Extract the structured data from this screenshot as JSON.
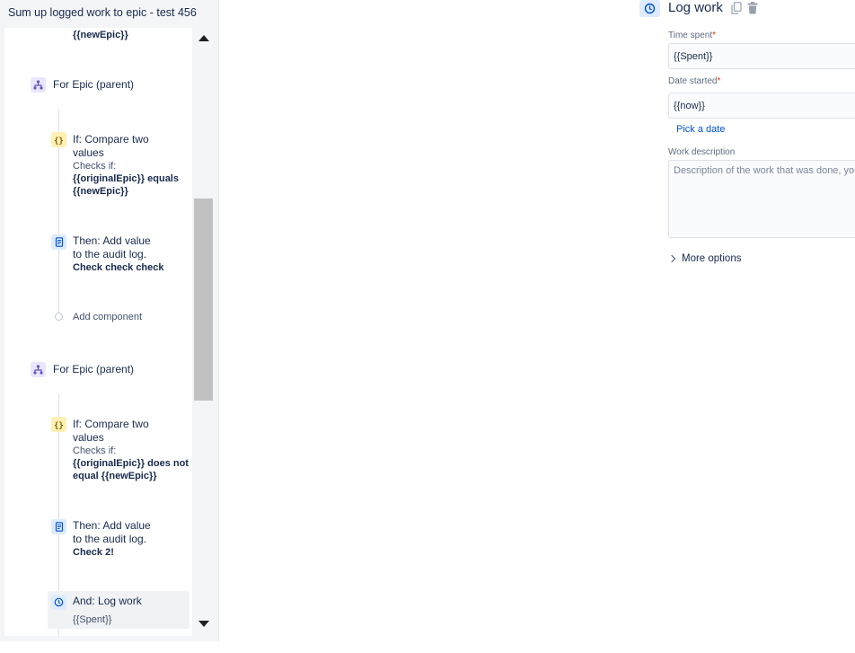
{
  "rule": {
    "title": "Sum up logged work to epic - test 456"
  },
  "components": {
    "top_fragment": "{{newEpic}}",
    "branch1": {
      "label": "For Epic (parent)"
    },
    "cond1": {
      "line1": "If: Compare two",
      "line2": "values",
      "checks": "Checks if:",
      "expr1": "{{originalEpic}} equals",
      "expr2": "{{newEpic}}"
    },
    "action1": {
      "line1": "Then: Add value",
      "line2": "to the audit log.",
      "detail": "Check check check"
    },
    "add_component": "Add component",
    "branch2": {
      "label": "For Epic (parent)"
    },
    "cond2": {
      "line1": "If: Compare two",
      "line2": "values",
      "checks": "Checks if:",
      "expr1": "{{originalEpic}} does not",
      "expr2": "equal {{newEpic}}"
    },
    "action2": {
      "line1": "Then: Add value",
      "line2": "to the audit log.",
      "detail": "Check 2!"
    },
    "action3": {
      "line1": "And: Log work",
      "detail": "{{Spent}}"
    }
  },
  "log_work": {
    "title": "Log work",
    "time_spent": {
      "label": "Time spent",
      "required": "*",
      "value": "{{Spent}}"
    },
    "date_started": {
      "label": "Date started",
      "required": "*",
      "value": "{{now}}"
    },
    "pick_date": "Pick a date",
    "work_description": {
      "label": "Work description",
      "placeholder": "Description of the work that was done, you can"
    },
    "more_options": "More options"
  },
  "colors": {
    "accent": "#0052cc",
    "branch_bg": "#eae6ff",
    "condition_bg": "#fff0b3",
    "action_bg": "#deebff",
    "required": "#de350b"
  },
  "icons": {
    "branch": "branch-icon",
    "condition": "braces-icon",
    "audit": "audit-log-icon",
    "clock": "clock-icon",
    "copy": "copy-icon",
    "delete": "trash-icon"
  }
}
